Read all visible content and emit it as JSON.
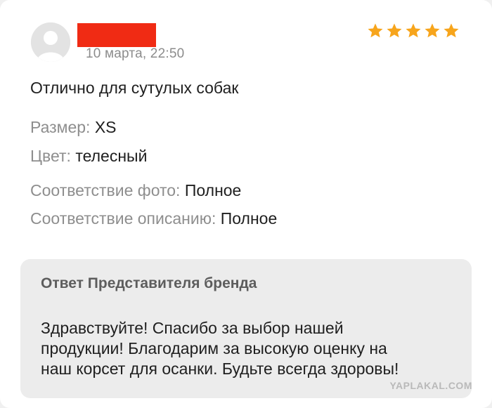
{
  "review": {
    "date": "10 марта, 22:50",
    "rating": 5,
    "star_color": "#f7a51c",
    "redaction_color": "#f02b14",
    "text": "Отлично для сутулых собак",
    "attributes": {
      "size_label": "Размер:",
      "size_value": "XS",
      "color_label": "Цвет:",
      "color_value": "телесный",
      "photo_match_label": "Соответствие фото:",
      "photo_match_value": "Полное",
      "desc_match_label": "Соответствие описанию:",
      "desc_match_value": "Полное"
    }
  },
  "reply": {
    "title": "Ответ Представителя бренда",
    "lines": [
      "Здравствуйте! Спасибо за выбор нашей",
      "продукции! Благодарим за высокую оценку на",
      "наш корсет для осанки. Будьте всегда здоровы!"
    ]
  },
  "watermark": "YAPLAKAL.COM"
}
